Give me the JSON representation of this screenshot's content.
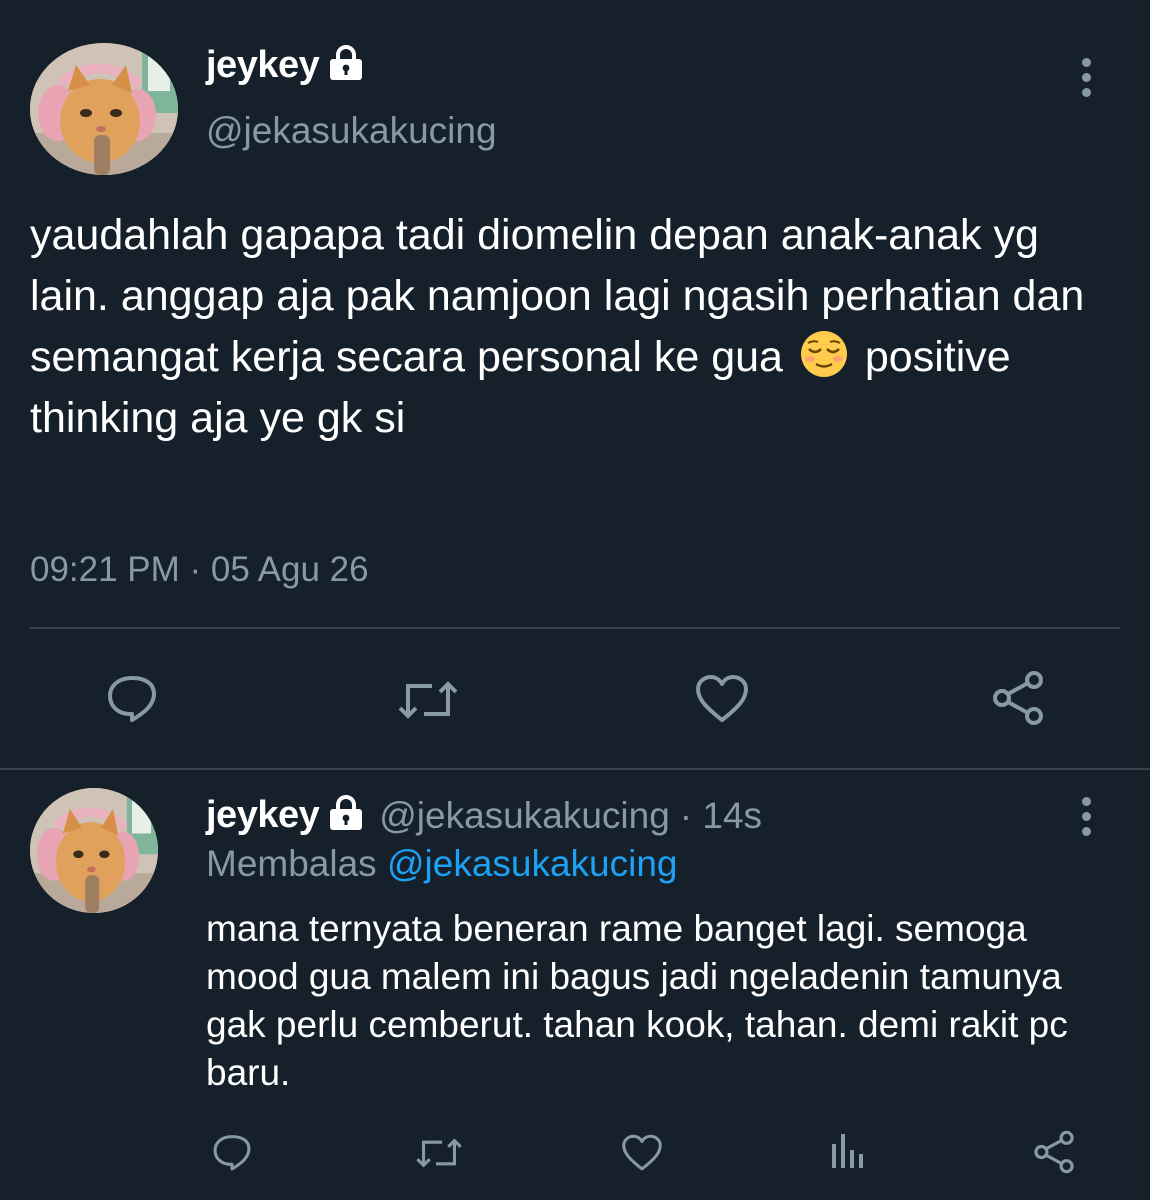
{
  "tweet": {
    "author": {
      "display_name": "jeykey",
      "handle": "@jekasukakucing",
      "avatar_icon": "cat-avatar",
      "locked": true
    },
    "text_before_emoji": "yaudahlah gapapa tadi diomelin depan anak-anak yg lain. anggap aja pak namjoon lagi ngasih perhatian dan semangat kerja secara personal ke gua",
    "emoji": "😌",
    "text_after_emoji": "positive thinking aja ye gk si",
    "timestamp": "09:21 PM · 05 Agu 26",
    "actions": [
      "reply-icon",
      "retweet-icon",
      "like-icon",
      "share-icon"
    ]
  },
  "reply": {
    "author": {
      "display_name": "jeykey",
      "handle": "@jekasukakucing",
      "locked": true
    },
    "time_ago": "· 14s",
    "replying_label": "Membalas",
    "replying_to": "@jekasukakucing",
    "text": "mana ternyata beneran rame banget lagi. semoga mood gua malem ini bagus jadi ngeladenin tamunya gak perlu cemberut. tahan kook, tahan. demi rakit pc baru.",
    "actions": [
      "reply-icon",
      "retweet-icon",
      "like-icon",
      "analytics-icon",
      "share-icon"
    ]
  },
  "colors": {
    "background": "#15202b",
    "text": "#ffffff",
    "secondary": "#8899a6",
    "link": "#1da1f2",
    "divider": "#38444d"
  }
}
